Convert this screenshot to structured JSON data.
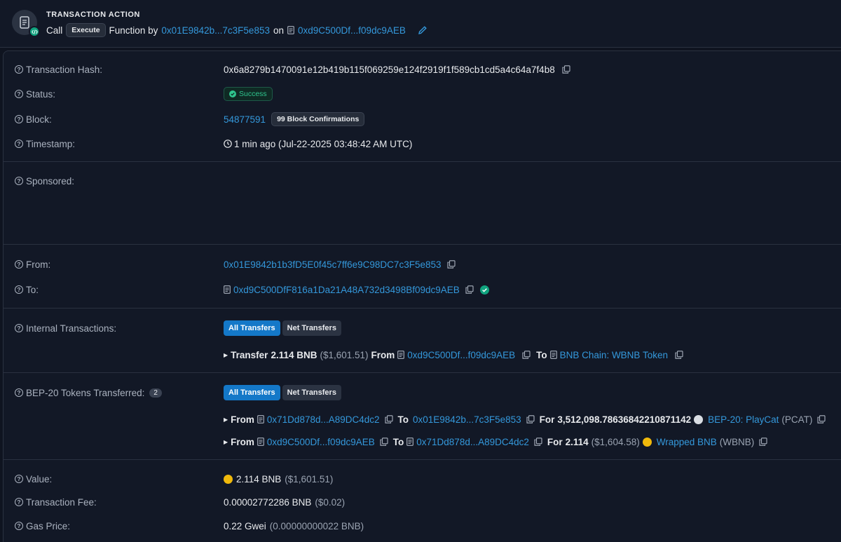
{
  "action": {
    "title": "TRANSACTION ACTION",
    "call_word": "Call",
    "method_badge": "Execute",
    "function_by": "Function by",
    "from_short": "0x01E9842b...7c3F5e853",
    "on_word": "on",
    "contract_short": "0xd9C500Df...f09dc9AEB"
  },
  "fields": {
    "tx_hash": {
      "label": "Transaction Hash:",
      "value": "0x6a8279b1470091e12b419b115f069259e124f2919f1f589cb1cd5a4c64a7f4b8"
    },
    "status": {
      "label": "Status:",
      "value": "Success"
    },
    "block": {
      "label": "Block:",
      "number": "54877591",
      "confirmations": "99 Block Confirmations"
    },
    "timestamp": {
      "label": "Timestamp:",
      "value": "1 min ago (Jul-22-2025 03:48:42 AM UTC)"
    },
    "sponsored": {
      "label": "Sponsored:"
    },
    "from": {
      "label": "From:",
      "value": "0x01E9842b1b3fD5E0f45c7ff6e9C98DC7c3F5e853"
    },
    "to": {
      "label": "To:",
      "value": "0xd9C500DfF816a1Da21A48A732d3498Bf09dc9AEB"
    },
    "internal": {
      "label": "Internal Transactions:",
      "tab_all": "All Transfers",
      "tab_net": "Net Transfers",
      "row": {
        "transfer_word": "Transfer",
        "amount": "2.114 BNB",
        "usd": "($1,601.51)",
        "from_word": "From",
        "from_addr": "0xd9C500Df...f09dc9AEB",
        "to_word": "To",
        "to_addr": "BNB Chain: WBNB Token"
      }
    },
    "tokens": {
      "label": "BEP-20 Tokens Transferred:",
      "count": "2",
      "tab_all": "All Transfers",
      "tab_net": "Net Transfers",
      "rows": [
        {
          "from_word": "From",
          "from_addr": "0x71Dd878d...A89DC4dc2",
          "to_word": "To",
          "to_addr": "0x01E9842b...7c3F5e853",
          "for_word": "For",
          "amount": "3,512,098.78636842210871142",
          "usd": "",
          "token_name": "BEP-20: PlayCat",
          "token_symbol": "(PCAT)"
        },
        {
          "from_word": "From",
          "from_addr": "0xd9C500Df...f09dc9AEB",
          "to_word": "To",
          "to_addr": "0x71Dd878d...A89DC4dc2",
          "for_word": "For",
          "amount": "2.114",
          "usd": "($1,604.58)",
          "token_name": "Wrapped BNB",
          "token_symbol": "(WBNB)"
        }
      ]
    },
    "value": {
      "label": "Value:",
      "amount": "2.114 BNB",
      "usd": "($1,601.51)"
    },
    "fee": {
      "label": "Transaction Fee:",
      "amount": "0.00002772286 BNB",
      "usd": "($0.02)"
    },
    "gas": {
      "label": "Gas Price:",
      "amount": "0.22 Gwei",
      "sub": "(0.00000000022 BNB)"
    }
  },
  "colors": {
    "link": "#3498db",
    "success": "#2fc58e",
    "active_tab": "#1478c8",
    "bnb_coin": "#f0b90b"
  }
}
